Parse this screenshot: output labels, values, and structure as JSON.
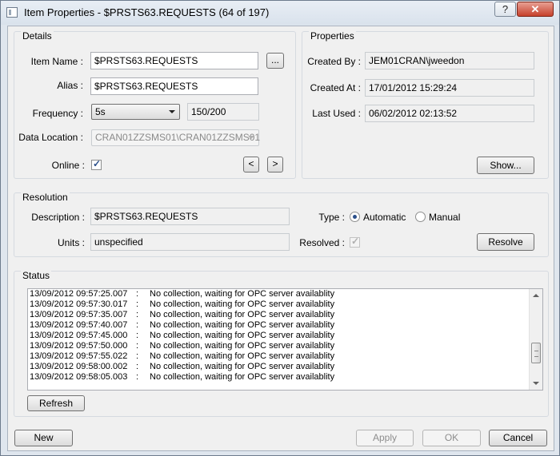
{
  "window": {
    "title": "Item Properties - $PRSTS63.REQUESTS (64 of 197)",
    "help_label": "?",
    "close_label": "✕"
  },
  "details": {
    "group_title": "Details",
    "item_name_label": "Item Name :",
    "item_name_value": "$PRSTS63.REQUESTS",
    "browse_label": "...",
    "alias_label": "Alias :",
    "alias_value": "$PRSTS63.REQUESTS",
    "frequency_label": "Frequency :",
    "frequency_value": "5s",
    "count_value": "150/200",
    "data_location_label": "Data Location :",
    "data_location_value": "CRAN01ZZSMS01\\CRAN01ZZSMS01",
    "online_label": "Online :",
    "online_checked": true,
    "prev_label": "<",
    "next_label": ">"
  },
  "properties": {
    "group_title": "Properties",
    "created_by_label": "Created By :",
    "created_by_value": "JEM01CRAN\\jweedon",
    "created_at_label": "Created At :",
    "created_at_value": "17/01/2012 15:29:24",
    "last_used_label": "Last Used :",
    "last_used_value": "06/02/2012 02:13:52",
    "show_label": "Show..."
  },
  "resolution": {
    "group_title": "Resolution",
    "description_label": "Description :",
    "description_value": "$PRSTS63.REQUESTS",
    "units_label": "Units :",
    "units_value": "unspecified",
    "type_label": "Type :",
    "automatic_label": "Automatic",
    "manual_label": "Manual",
    "selected_type": "Automatic",
    "resolved_label": "Resolved :",
    "resolved_checked": true,
    "resolve_label": "Resolve"
  },
  "status": {
    "group_title": "Status",
    "log": [
      {
        "time": "13/09/2012 09:57:25.007",
        "sep": ":",
        "message": "No collection, waiting for OPC server availablity"
      },
      {
        "time": "13/09/2012 09:57:30.017",
        "sep": ":",
        "message": "No collection, waiting for OPC server availablity"
      },
      {
        "time": "13/09/2012 09:57:35.007",
        "sep": ":",
        "message": "No collection, waiting for OPC server availablity"
      },
      {
        "time": "13/09/2012 09:57:40.007",
        "sep": ":",
        "message": "No collection, waiting for OPC server availablity"
      },
      {
        "time": "13/09/2012 09:57:45.000",
        "sep": ":",
        "message": "No collection, waiting for OPC server availablity"
      },
      {
        "time": "13/09/2012 09:57:50.000",
        "sep": ":",
        "message": "No collection, waiting for OPC server availablity"
      },
      {
        "time": "13/09/2012 09:57:55.022",
        "sep": ":",
        "message": "No collection, waiting for OPC server availablity"
      },
      {
        "time": "13/09/2012 09:58:00.002",
        "sep": ":",
        "message": "No collection, waiting for OPC server availablity"
      },
      {
        "time": "13/09/2012 09:58:05.003",
        "sep": ":",
        "message": "No collection, waiting for OPC server availablity"
      }
    ],
    "refresh_label": "Refresh"
  },
  "footer": {
    "new_label": "New",
    "apply_label": "Apply",
    "ok_label": "OK",
    "cancel_label": "Cancel"
  }
}
